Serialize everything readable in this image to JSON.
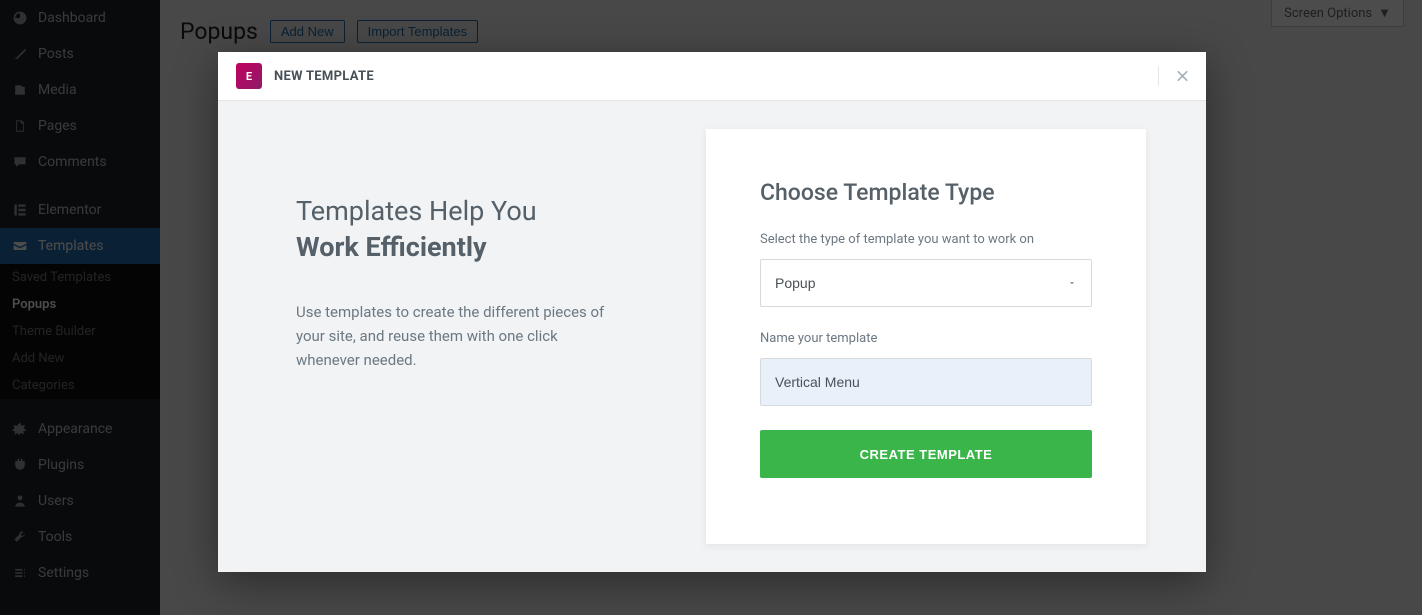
{
  "sidebar": {
    "items": [
      {
        "label": "Dashboard"
      },
      {
        "label": "Posts"
      },
      {
        "label": "Media"
      },
      {
        "label": "Pages"
      },
      {
        "label": "Comments"
      },
      {
        "label": "Elementor"
      },
      {
        "label": "Templates"
      },
      {
        "label": "Appearance"
      },
      {
        "label": "Plugins"
      },
      {
        "label": "Users"
      },
      {
        "label": "Tools"
      },
      {
        "label": "Settings"
      }
    ],
    "subitems": [
      {
        "label": "Saved Templates"
      },
      {
        "label": "Popups"
      },
      {
        "label": "Theme Builder"
      },
      {
        "label": "Add New"
      },
      {
        "label": "Categories"
      }
    ]
  },
  "screen_options": "Screen Options",
  "page": {
    "title": "Popups",
    "add_new": "Add New",
    "import": "Import Templates"
  },
  "modal": {
    "title": "NEW TEMPLATE",
    "left_title_line1": "Templates Help You",
    "left_title_line2": "Work Efficiently",
    "left_desc": "Use templates to create the different pieces of your site, and reuse them with one click whenever needed.",
    "right_title": "Choose Template Type",
    "label_type": "Select the type of template you want to work on",
    "type_value": "Popup",
    "label_name": "Name your template",
    "name_value": "Vertical Menu",
    "create_button": "CREATE TEMPLATE"
  }
}
